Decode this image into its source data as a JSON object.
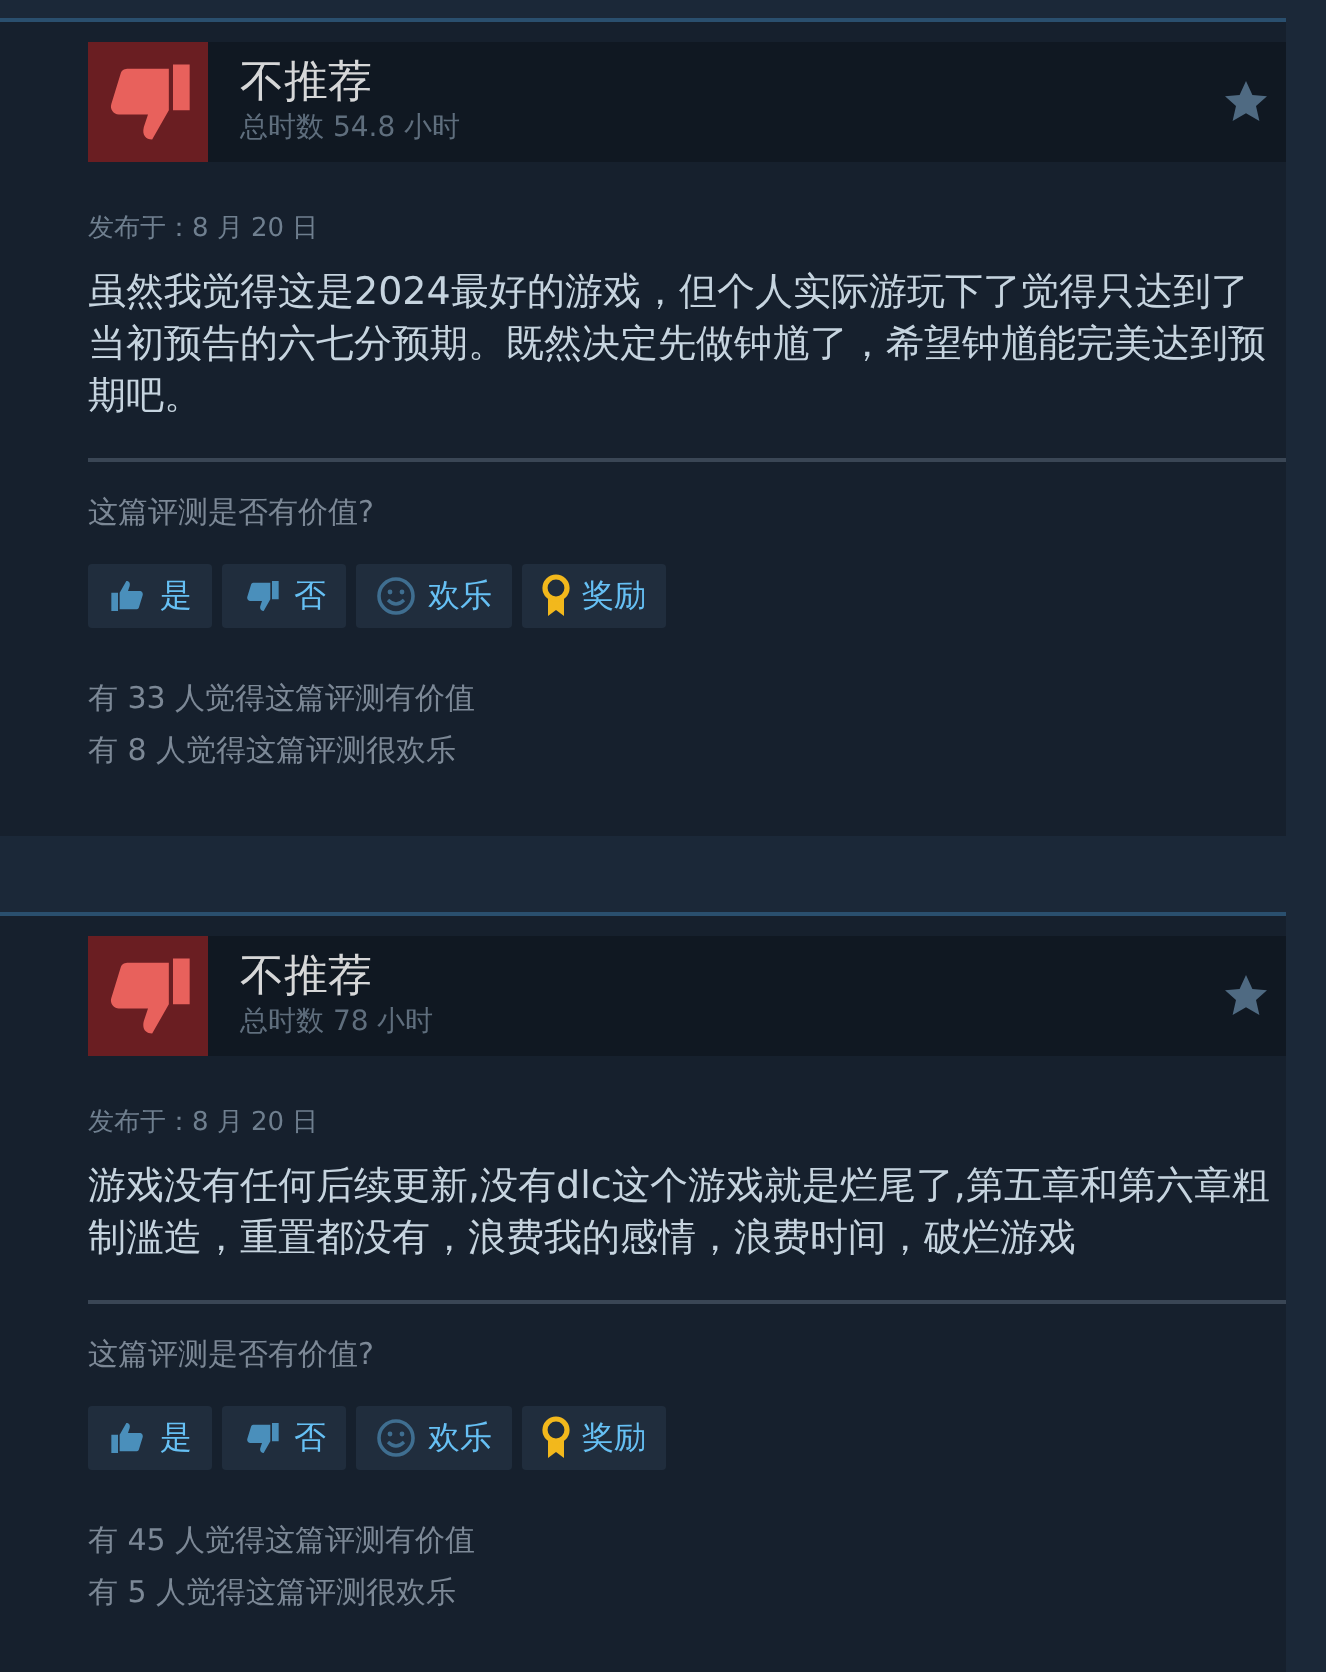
{
  "reviews": [
    {
      "recommended": false,
      "verdict": "不推荐",
      "hours": "总时数 54.8 小时",
      "posted": "发布于：8 月 20 日",
      "body": "虽然我觉得这是2024最好的游戏，但个人实际游玩下了觉得只达到了当初预告的六七分预期。既然决定先做钟馗了，希望钟馗能完美达到预期吧。",
      "question": "这篇评测是否有价值?",
      "buttons": [
        {
          "kind": "yes",
          "label": "是"
        },
        {
          "kind": "no",
          "label": "否"
        },
        {
          "kind": "funny",
          "label": "欢乐"
        },
        {
          "kind": "award",
          "label": "奖励"
        }
      ],
      "stats": [
        "有 33 人觉得这篇评测有价值",
        "有 8 人觉得这篇评测很欢乐"
      ]
    },
    {
      "recommended": false,
      "verdict": "不推荐",
      "hours": "总时数 78 小时",
      "posted": "发布于：8 月 20 日",
      "body": "游戏没有任何后续更新,没有dlc这个游戏就是烂尾了,第五章和第六章粗制滥造，重置都没有，浪费我的感情，浪费时间，破烂游戏",
      "question": "这篇评测是否有价值?",
      "buttons": [
        {
          "kind": "yes",
          "label": "是"
        },
        {
          "kind": "no",
          "label": "否"
        },
        {
          "kind": "funny",
          "label": "欢乐"
        },
        {
          "kind": "award",
          "label": "奖励"
        }
      ],
      "stats": [
        "有 45 人觉得这篇评测有价值",
        "有 5 人觉得这篇评测很欢乐"
      ]
    }
  ]
}
